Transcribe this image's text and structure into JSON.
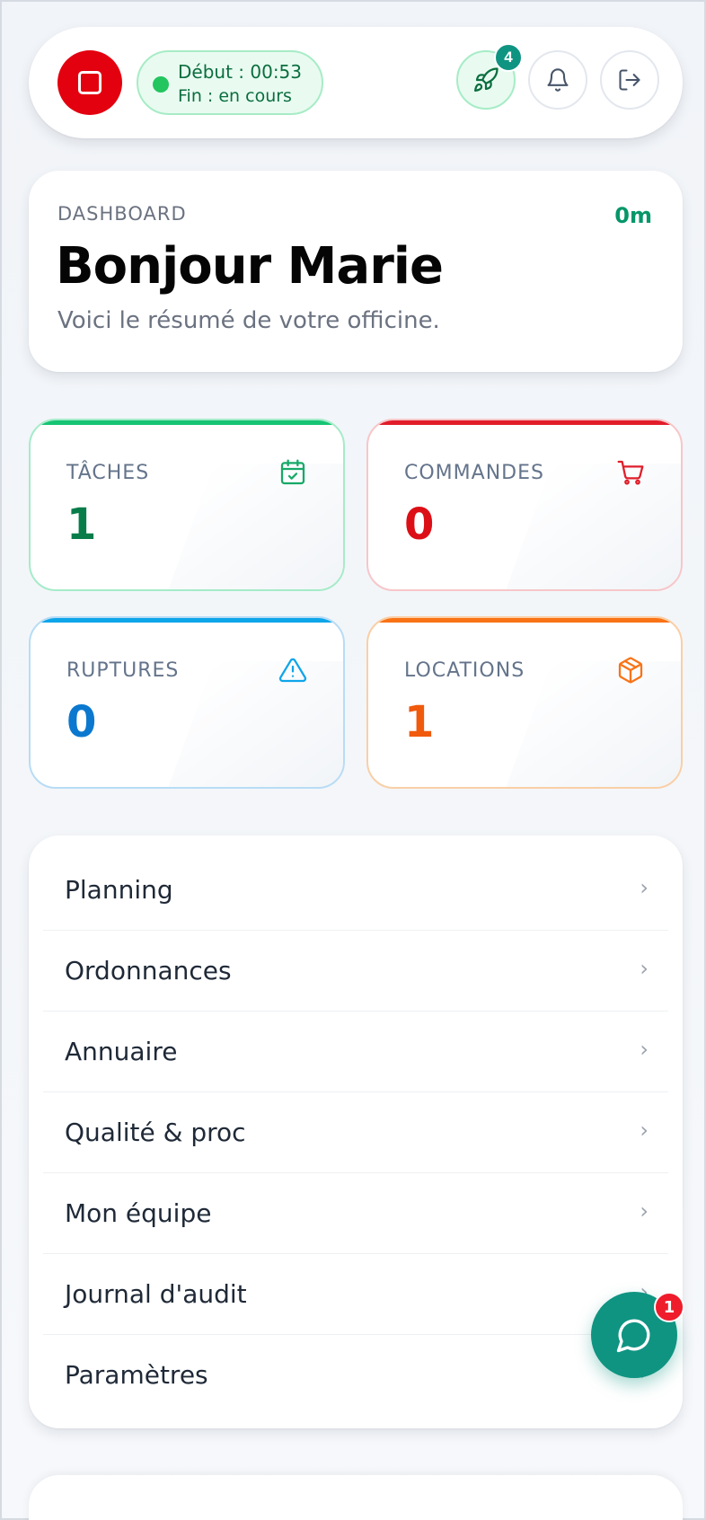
{
  "topbar": {
    "shift_start": "Début : 00:53",
    "shift_end": "Fin : en cours",
    "rocket_badge": "4"
  },
  "greeting": {
    "kicker": "DASHBOARD",
    "timer": "0m",
    "title": "Bonjour Marie",
    "subtitle": "Voici le résumé de votre officine."
  },
  "stats": [
    {
      "label": "TÂCHES",
      "value": "1",
      "icon": "calendar-check-icon",
      "accent": "#16c474"
    },
    {
      "label": "COMMANDES",
      "value": "0",
      "icon": "cart-icon",
      "accent": "#e11d2a"
    },
    {
      "label": "RUPTURES",
      "value": "0",
      "icon": "warning-icon",
      "accent": "#0ea5e9"
    },
    {
      "label": "LOCATIONS",
      "value": "1",
      "icon": "box-icon",
      "accent": "#f97316"
    }
  ],
  "menu": {
    "items": [
      {
        "label": "Planning",
        "chevron": "›"
      },
      {
        "label": "Ordonnances",
        "chevron": "›"
      },
      {
        "label": "Annuaire",
        "chevron": "›"
      },
      {
        "label": "Qualité & proc",
        "chevron": "›"
      },
      {
        "label": "Mon équipe",
        "chevron": "›"
      },
      {
        "label": "Journal d'audit",
        "chevron": "›"
      },
      {
        "label": "Paramètres",
        "chevron": "›"
      }
    ]
  },
  "chat": {
    "badge": "1"
  },
  "colors": {
    "brand_teal": "#0f9482",
    "stop_red": "#e3000f"
  }
}
